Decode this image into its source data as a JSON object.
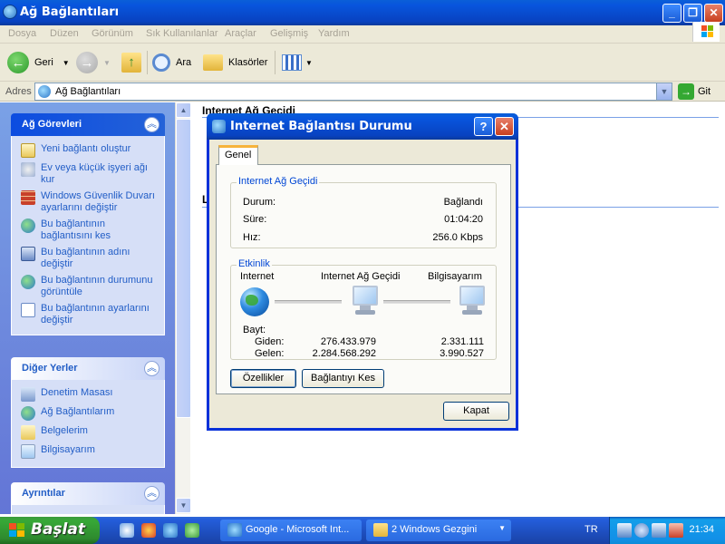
{
  "window": {
    "title": "Ağ Bağlantıları",
    "buttons": {
      "minimize": "_",
      "maximize": "❐",
      "close": "✕"
    }
  },
  "menu": [
    "Dosya",
    "Düzen",
    "Görünüm",
    "Sık Kullanılanlar",
    "Araçlar",
    "Gelişmiş",
    "Yardım"
  ],
  "toolbar": {
    "back_label": "Geri",
    "search_label": "Ara",
    "folders_label": "Klasörler"
  },
  "address": {
    "label": "Adres",
    "value": "Ağ Bağlantıları",
    "go_label": "Git"
  },
  "sidebar": {
    "network_tasks": {
      "title": "Ağ Görevleri",
      "items": [
        {
          "label": "Yeni bağlantı oluştur",
          "icon": "new-connection-icon"
        },
        {
          "label": "Ev veya küçük işyeri ağı kur",
          "icon": "home-network-icon"
        },
        {
          "label": "Windows Güvenlik Duvarı ayarlarını değiştir",
          "icon": "firewall-icon"
        },
        {
          "label": "Bu bağlantının bağlantısını kes",
          "icon": "disconnect-icon"
        },
        {
          "label": "Bu bağlantının adını değiştir",
          "icon": "rename-icon"
        },
        {
          "label": "Bu bağlantının durumunu görüntüle",
          "icon": "status-icon"
        },
        {
          "label": "Bu bağlantının ayarlarını değiştir",
          "icon": "settings-icon"
        }
      ]
    },
    "other_places": {
      "title": "Diğer Yerler",
      "items": [
        {
          "label": "Denetim Masası",
          "icon": "control-panel-icon"
        },
        {
          "label": "Ağ Bağlantılarım",
          "icon": "network-places-icon"
        },
        {
          "label": "Belgelerim",
          "icon": "documents-icon"
        },
        {
          "label": "Bilgisayarım",
          "icon": "my-computer-icon"
        }
      ]
    },
    "details": {
      "title": "Ayrıntılar"
    }
  },
  "main": {
    "header1": "Internet Ağ Geçidi",
    "header2": "L"
  },
  "dialog": {
    "title": "Internet Bağlantısı Durumu",
    "tab": "Genel",
    "gateway_group": {
      "title": "Internet Ağ Geçidi",
      "rows": [
        {
          "label": "Durum:",
          "value": "Bağlandı"
        },
        {
          "label": "Süre:",
          "value": "01:04:20"
        },
        {
          "label": "Hız:",
          "value": "256.0 Kbps"
        }
      ]
    },
    "activity_group": {
      "title": "Etkinlik",
      "nodes": [
        "Internet",
        "Internet Ağ Geçidi",
        "Bilgisayarım"
      ],
      "bytes_label": "Bayt:",
      "sent_label": "Giden:",
      "received_label": "Gelen:",
      "gateway_sent": "276.433.979",
      "gateway_received": "2.284.568.292",
      "computer_sent": "2.331.111",
      "computer_received": "3.990.527"
    },
    "properties_button": "Özellikler",
    "disconnect_button": "Bağlantıyı Kes",
    "close_button": "Kapat"
  },
  "taskbar": {
    "start_label": "Başlat",
    "tasks": [
      {
        "label": "Google - Microsoft Int..."
      },
      {
        "label": "2 Windows Gezgini"
      }
    ],
    "language": "TR",
    "clock": "21:34"
  }
}
